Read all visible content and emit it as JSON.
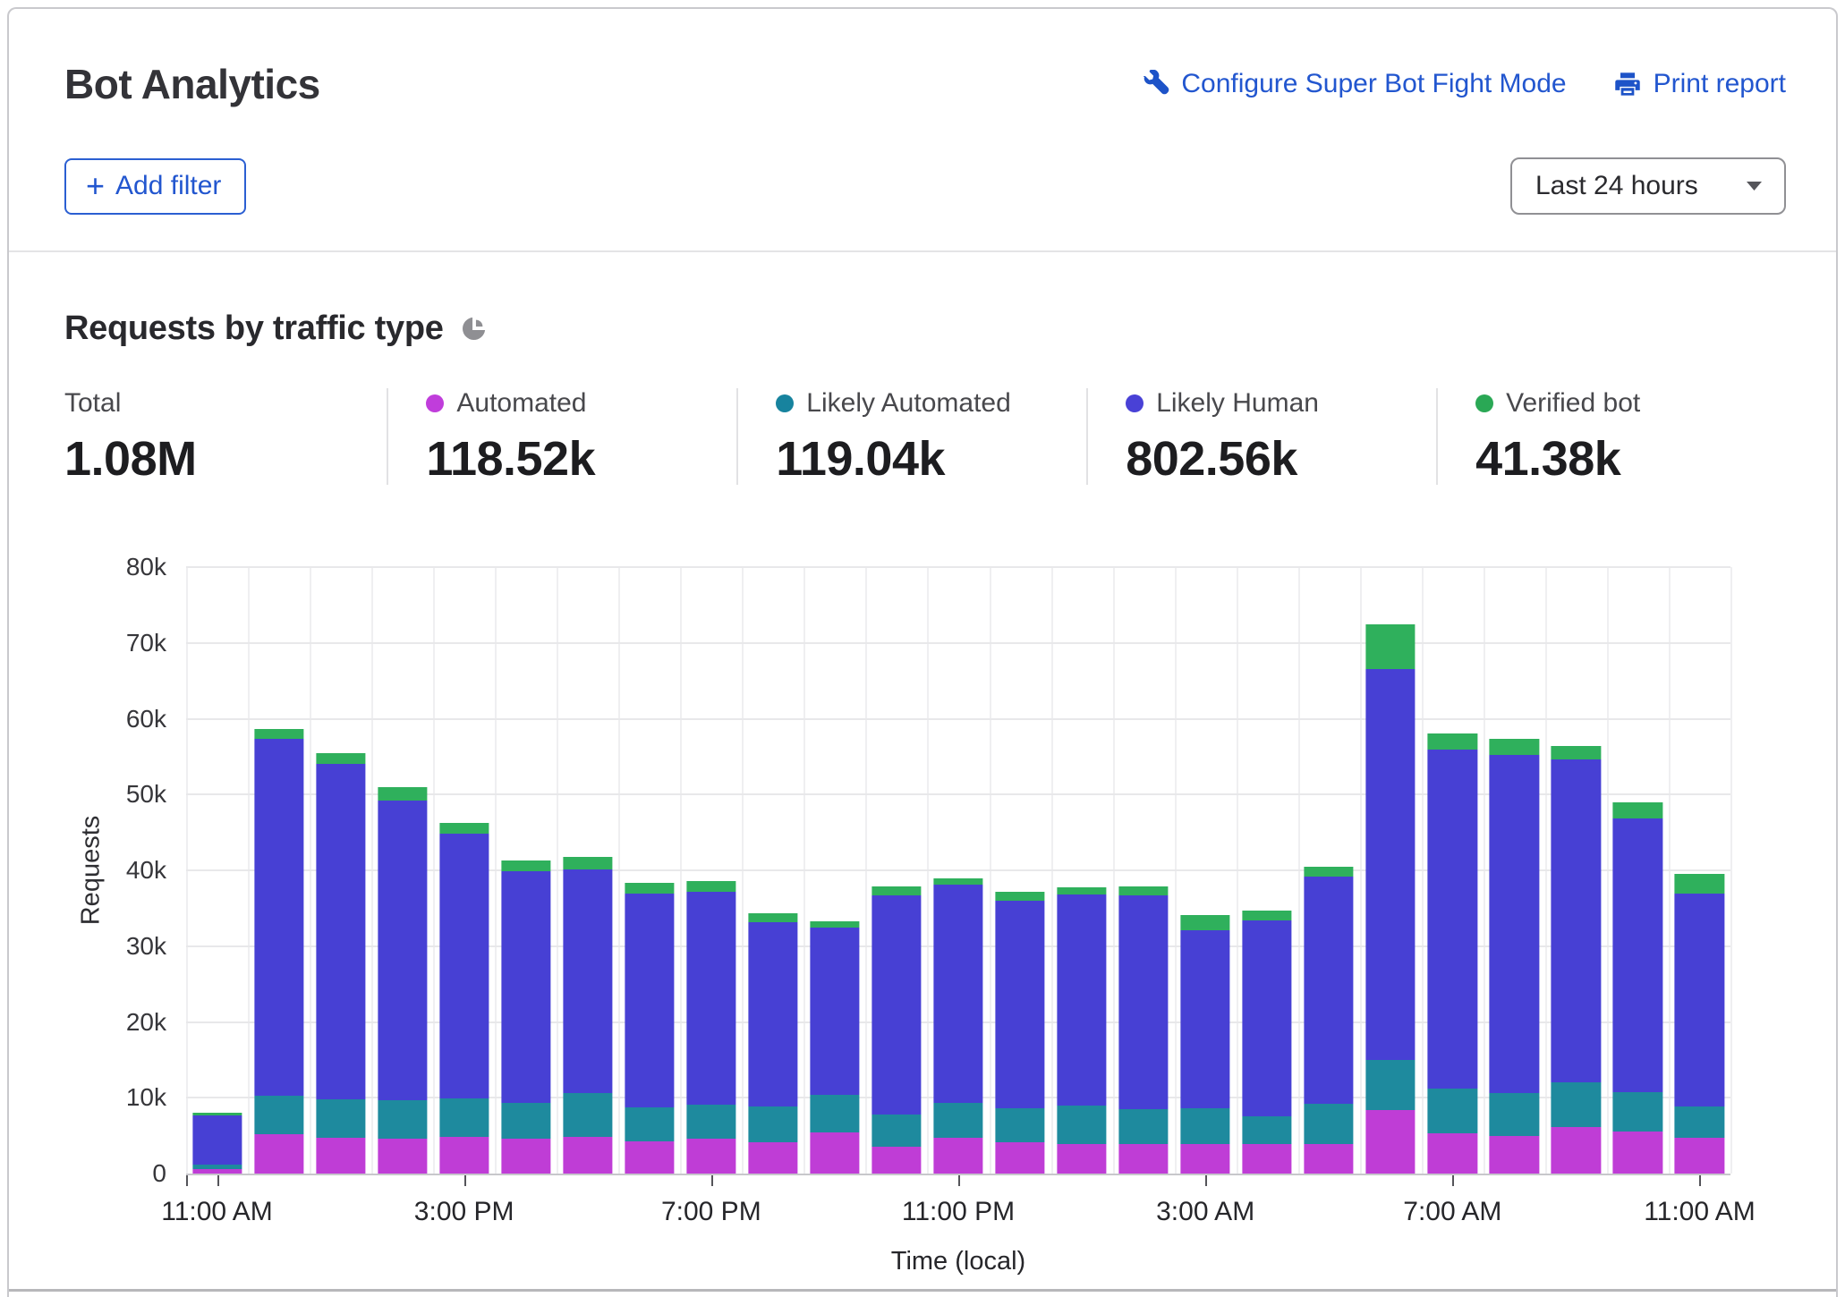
{
  "card": {
    "title": "Bot Analytics",
    "actions": {
      "configure_label": "Configure Super Bot Fight Mode",
      "print_label": "Print report"
    },
    "filter_button_label": "Add filter",
    "plus_glyph": "+",
    "time_range": {
      "selected": "Last 24 hours"
    }
  },
  "section": {
    "title": "Requests by traffic type"
  },
  "stats": [
    {
      "label": "Total",
      "value": "1.08M",
      "color": null
    },
    {
      "label": "Automated",
      "value": "118.52k",
      "color": "#c03ddb"
    },
    {
      "label": "Likely Automated",
      "value": "119.04k",
      "color": "#17839e"
    },
    {
      "label": "Likely Human",
      "value": "802.56k",
      "color": "#4941d6"
    },
    {
      "label": "Verified bot",
      "value": "41.38k",
      "color": "#2aa855"
    }
  ],
  "chart_data": {
    "type": "bar",
    "stacked": true,
    "title": "Requests by traffic type",
    "xlabel": "Time (local)",
    "ylabel": "Requests",
    "ylim": [
      0,
      80000
    ],
    "grid": true,
    "legend_position": "top-stats-row",
    "categories": [
      "11:00 AM",
      "12:00 PM",
      "1:00 PM",
      "2:00 PM",
      "3:00 PM",
      "4:00 PM",
      "5:00 PM",
      "6:00 PM",
      "7:00 PM",
      "8:00 PM",
      "9:00 PM",
      "10:00 PM",
      "11:00 PM",
      "12:00 AM",
      "1:00 AM",
      "2:00 AM",
      "3:00 AM",
      "4:00 AM",
      "5:00 AM",
      "6:00 AM",
      "7:00 AM",
      "8:00 AM",
      "9:00 AM",
      "10:00 AM",
      "11:00 AM"
    ],
    "series": [
      {
        "name": "Automated",
        "color": "#bf3dd6",
        "values": [
          600,
          5200,
          4700,
          4600,
          4850,
          4600,
          4850,
          4300,
          4600,
          4150,
          5400,
          3550,
          4700,
          4150,
          3850,
          3950,
          3900,
          3900,
          3950,
          8350,
          5300,
          5000,
          6100,
          5500,
          4750
        ]
      },
      {
        "name": "Likely Automated",
        "color": "#1e8a9e",
        "values": [
          600,
          5100,
          5100,
          5100,
          5100,
          4700,
          5800,
          4400,
          4500,
          4700,
          5000,
          4200,
          4600,
          4450,
          5150,
          4550,
          4750,
          3700,
          5250,
          6650,
          5900,
          5600,
          5900,
          5200,
          4100
        ]
      },
      {
        "name": "Likely Human",
        "color": "#4740d4",
        "values": [
          6500,
          47000,
          44200,
          39500,
          34850,
          30600,
          29500,
          28200,
          28100,
          24350,
          22000,
          28900,
          28800,
          27400,
          27800,
          28200,
          23400,
          25800,
          30000,
          51500,
          44700,
          44600,
          42600,
          36200,
          28050
        ]
      },
      {
        "name": "Verified bot",
        "color": "#2fb05c",
        "values": [
          300,
          1300,
          1500,
          1800,
          1500,
          1400,
          1600,
          1400,
          1400,
          1100,
          900,
          1200,
          800,
          1200,
          1000,
          1200,
          2000,
          1300,
          1300,
          5900,
          2100,
          2200,
          1800,
          2100,
          2600
        ]
      }
    ],
    "yticks": [
      {
        "value": 0,
        "label": "0"
      },
      {
        "value": 10000,
        "label": "10k"
      },
      {
        "value": 20000,
        "label": "20k"
      },
      {
        "value": 30000,
        "label": "30k"
      },
      {
        "value": 40000,
        "label": "40k"
      },
      {
        "value": 50000,
        "label": "50k"
      },
      {
        "value": 60000,
        "label": "60k"
      },
      {
        "value": 70000,
        "label": "70k"
      },
      {
        "value": 80000,
        "label": "80k"
      }
    ],
    "xticks": [
      {
        "index": 0,
        "label": "11:00 AM"
      },
      {
        "index": 4,
        "label": "3:00 PM"
      },
      {
        "index": 8,
        "label": "7:00 PM"
      },
      {
        "index": 12,
        "label": "11:00 PM"
      },
      {
        "index": 16,
        "label": "3:00 AM"
      },
      {
        "index": 20,
        "label": "7:00 AM"
      },
      {
        "index": 24,
        "label": "11:00 AM"
      }
    ]
  }
}
